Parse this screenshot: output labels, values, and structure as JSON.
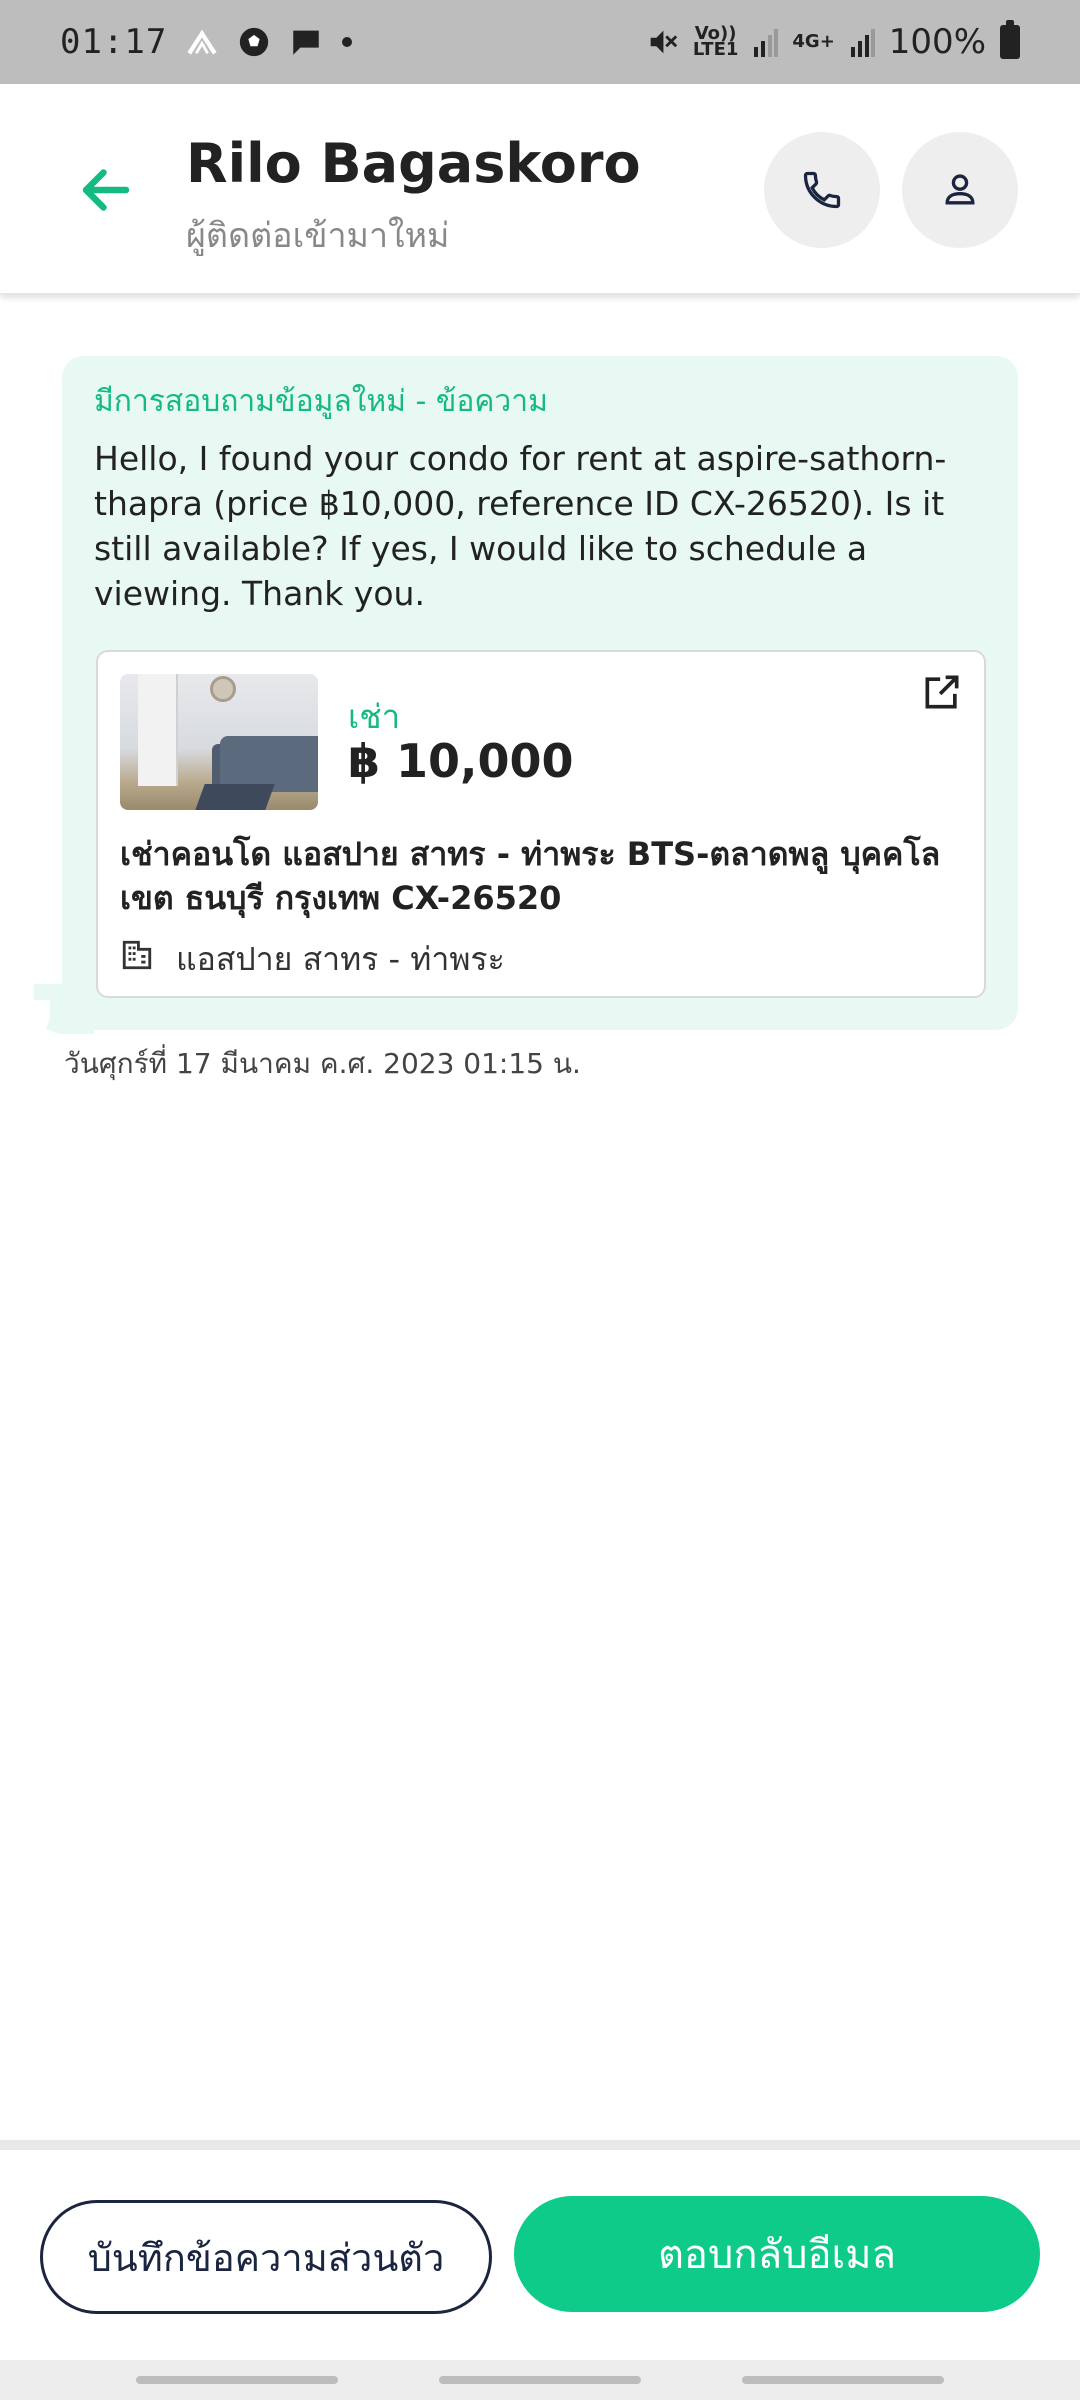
{
  "status_bar": {
    "time": "01:17",
    "volte_label": "Vo))\nLTE1",
    "network_label": "4G+",
    "battery": "100%"
  },
  "header": {
    "name": "Rilo Bagaskoro",
    "subtitle": "ผู้ติดต่อเข้ามาใหม่"
  },
  "message": {
    "label": "มีการสอบถามข้อมูลใหม่ - ข้อความ",
    "text": "Hello, I found your condo for rent at aspire-sathorn-thapra (price ฿10,000, reference ID CX-26520). Is it still available? If yes, I would like to schedule a viewing. Thank you.",
    "timestamp": "วันศุกร์ที่ 17 มีนาคม ค.ศ. 2023 01:15 น."
  },
  "listing": {
    "type": "เช่า",
    "price": "฿ 10,000",
    "title": "เช่าคอนโด  แอสปาย สาทร - ท่าพระ BTS-ตลาดพลู บุคคโล เขต ธนบุรี กรุงเทพ CX-26520",
    "project": "แอสปาย สาทร - ท่าพระ"
  },
  "actions": {
    "note_label": "บันทึกข้อความส่วนตัว",
    "reply_label": "ตอบกลับอีเมล"
  },
  "colors": {
    "accent": "#0fcb8a",
    "accent_text": "#15b982",
    "bubble": "#e8f8f2",
    "navy": "#1b2540"
  }
}
